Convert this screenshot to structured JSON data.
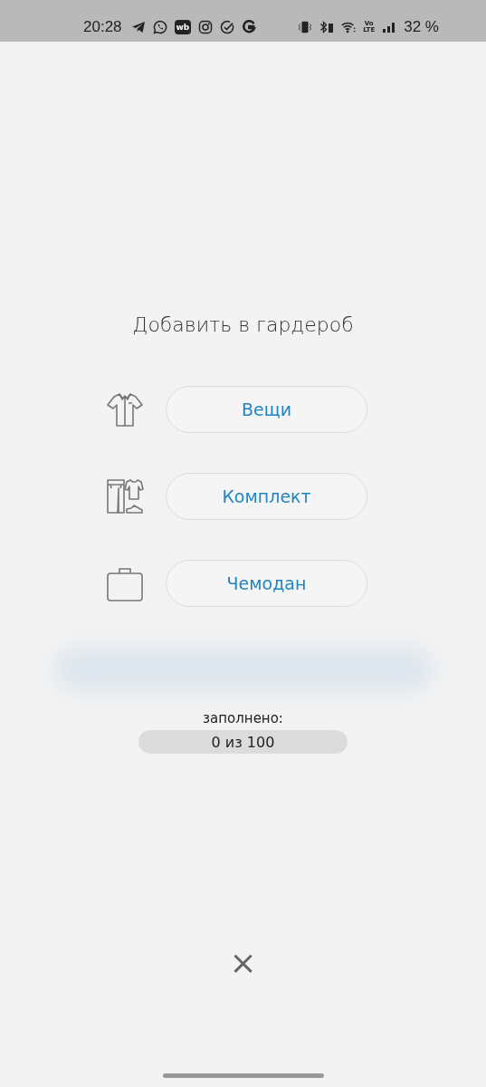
{
  "status_bar": {
    "time": "20:28",
    "app_icons": [
      {
        "kind": "telegram"
      },
      {
        "kind": "whatsapp"
      },
      {
        "kind": "wb",
        "label": "wb"
      },
      {
        "kind": "instagram"
      },
      {
        "kind": "check"
      },
      {
        "kind": "google"
      }
    ],
    "volte": {
      "top": "Vo",
      "bottom": "LTE"
    },
    "battery": "32 %"
  },
  "title": "Добавить в гардероб",
  "options": [
    {
      "kind": "shirt",
      "label": "Вещи"
    },
    {
      "kind": "outfit",
      "label": "Комплект"
    },
    {
      "kind": "suitcase",
      "label": "Чемодан"
    }
  ],
  "fill": {
    "label": "заполнено:",
    "reading": "0 из 100"
  },
  "close": "×"
}
